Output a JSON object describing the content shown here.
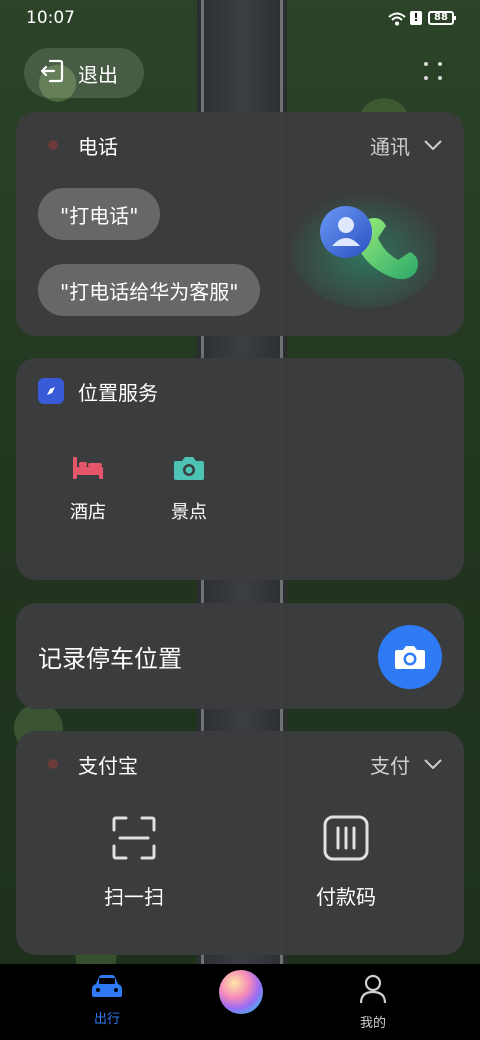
{
  "status_bar": {
    "time": "10:07",
    "battery": "88"
  },
  "top": {
    "exit_label": "退出"
  },
  "phone_card": {
    "title": "电话",
    "tag": "通讯",
    "suggestions": [
      "\"打电话\"",
      "\"打电话给华为客服\""
    ]
  },
  "location_card": {
    "title": "位置服务",
    "items": [
      {
        "label": "酒店",
        "icon": "hotel-bed-icon"
      },
      {
        "label": "景点",
        "icon": "camera-icon"
      }
    ]
  },
  "parking_card": {
    "title": "记录停车位置",
    "icon": "camera-icon"
  },
  "alipay_card": {
    "title": "支付宝",
    "tag": "支付",
    "actions": [
      {
        "label": "扫一扫",
        "icon": "scan-icon"
      },
      {
        "label": "付款码",
        "icon": "payment-code-icon"
      }
    ]
  },
  "bottom_nav": {
    "items": [
      {
        "label": "出行",
        "icon": "car-icon",
        "active": true
      },
      {
        "label": "我的",
        "icon": "person-icon",
        "active": false
      }
    ]
  },
  "colors": {
    "accent": "#2f7bf6",
    "card": "#3c3c3e",
    "hotel": "#e5566b",
    "camera": "#4cc3b5"
  }
}
